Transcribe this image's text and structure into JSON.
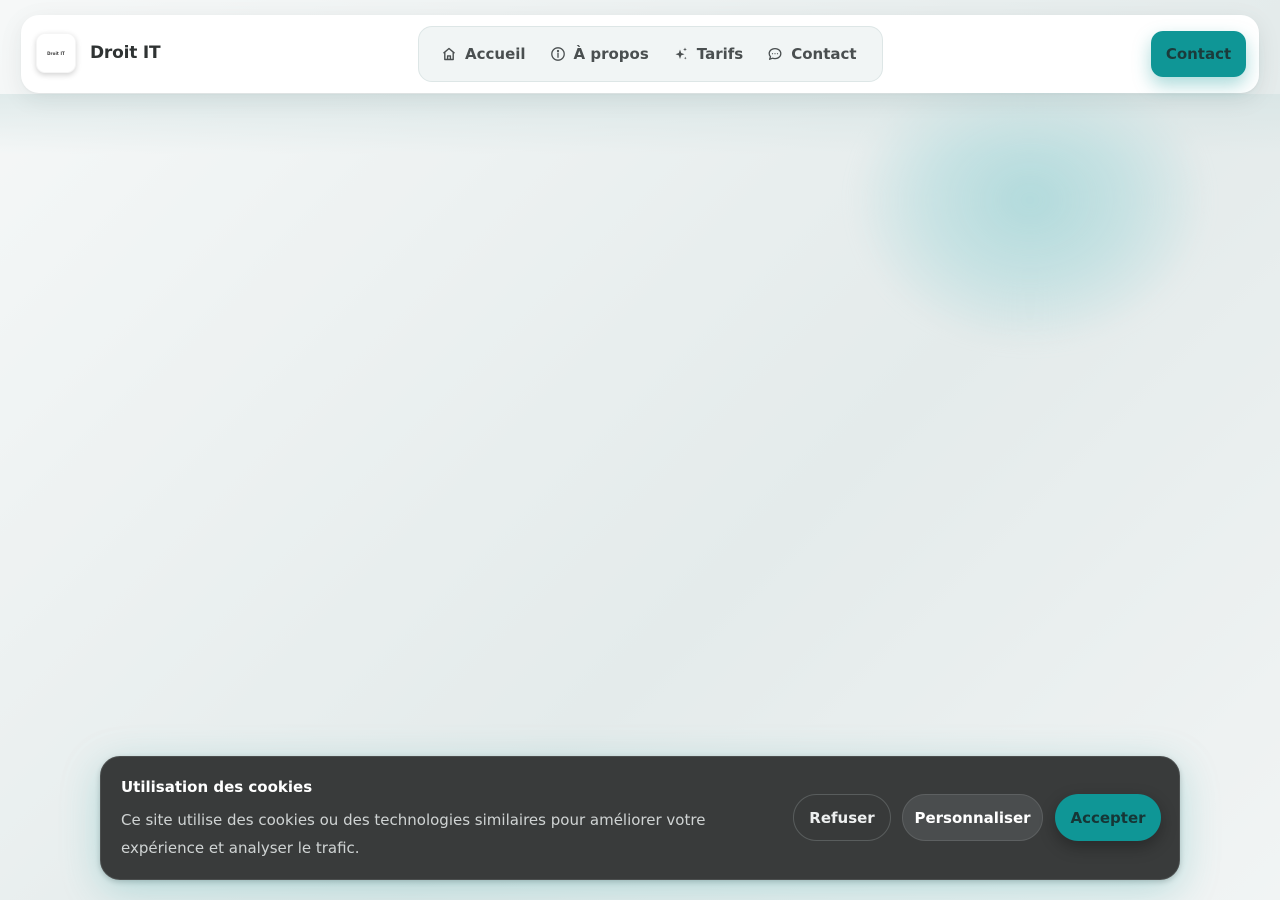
{
  "header": {
    "logo_text": "Droit IT",
    "brand": "Droit IT",
    "nav": [
      {
        "label": "Accueil",
        "icon": "home-icon"
      },
      {
        "label": "À propos",
        "icon": "info-icon"
      },
      {
        "label": "Tarifs",
        "icon": "sparkles-icon"
      },
      {
        "label": "Contact",
        "icon": "chat-bubble-icon"
      }
    ],
    "cta_label": "Contact"
  },
  "cookie_banner": {
    "title": "Utilisation des cookies",
    "text": "Ce site utilise des cookies ou des technologies similaires pour améliorer votre expérience et analyser le trafic.",
    "refuse_label": "Refuser",
    "customize_label": "Personnaliser",
    "accept_label": "Accepter"
  },
  "colors": {
    "accent": "#0f9696",
    "banner_bg": "#393b3b",
    "nav_bg": "#f1f5f5"
  }
}
